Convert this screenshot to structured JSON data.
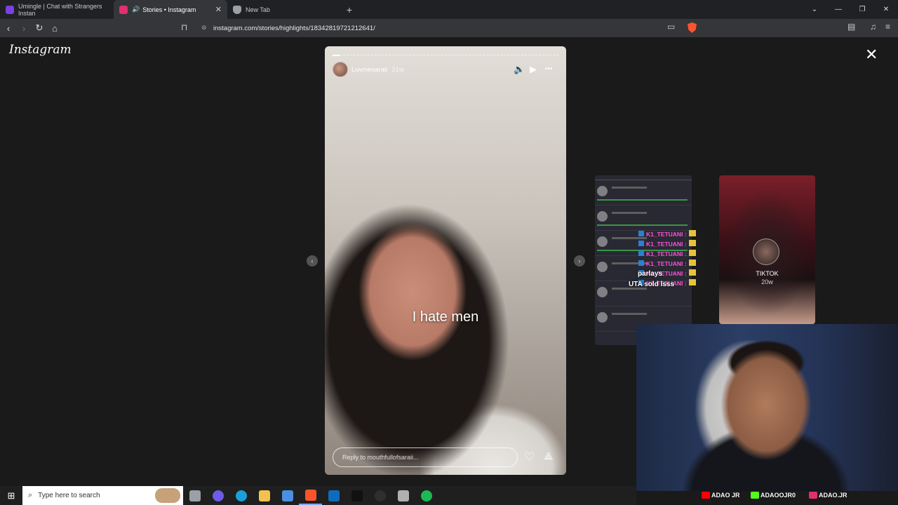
{
  "browser": {
    "tabs": [
      {
        "label": "Umingle | Chat with Strangers Instan",
        "favicon_color": "#7b3fe4"
      },
      {
        "label": "Stories • Instagram",
        "favicon_color": "#e1306c",
        "audio": "🔊"
      },
      {
        "label": "New Tab",
        "favicon_color": "#9aa0a6"
      }
    ],
    "new_tab": "+",
    "url": "instagram.com/stories/highlights/18342819721212641/",
    "window_controls": {
      "dropdown": "⌄",
      "minimize": "—",
      "restore": "❐",
      "close": "✕"
    }
  },
  "instagram": {
    "logo": "Instagram",
    "close": "✕",
    "story": {
      "username": "Luvmesaraii",
      "age": "21w",
      "progress": 0.03,
      "caption": "I hate men",
      "reply_placeholder": "Reply to mouthfullofsaraii...",
      "icons": {
        "mute": "🔈",
        "play": "▶",
        "more": "•••",
        "heart": "♡",
        "send": "⟁"
      }
    },
    "prev_arrow": "‹",
    "next_arrow": "›",
    "next_story": {
      "username": "TIKTOK",
      "age": "20w"
    }
  },
  "stream_overlay": {
    "chat_user": "K1_TETUANI",
    "chat_rows": 6,
    "overlay_line1": "parlays",
    "overlay_line2": "UTA sold lsss",
    "handles": [
      "ADAO JR",
      "ADAOOJR0",
      "ADAO.JR"
    ]
  },
  "taskbar": {
    "start_icon": "⊞",
    "search_placeholder": "Type here to search",
    "search_icon": "⌕",
    "apps": [
      {
        "name": "task-view",
        "color": "#9aa0a6"
      },
      {
        "name": "copilot",
        "color": "#6c5ce7"
      },
      {
        "name": "edge",
        "color": "#1aa0d8"
      },
      {
        "name": "file-explorer",
        "color": "#f2c14e"
      },
      {
        "name": "store",
        "color": "#4a90e2"
      },
      {
        "name": "brave",
        "color": "#fb542b",
        "active": true
      },
      {
        "name": "outlook",
        "color": "#0f6cbd"
      },
      {
        "name": "capcut",
        "color": "#111111"
      },
      {
        "name": "obs",
        "color": "#302e31"
      },
      {
        "name": "winrar",
        "color": "#b0b0b0"
      },
      {
        "name": "spotify",
        "color": "#1db954"
      }
    ]
  }
}
